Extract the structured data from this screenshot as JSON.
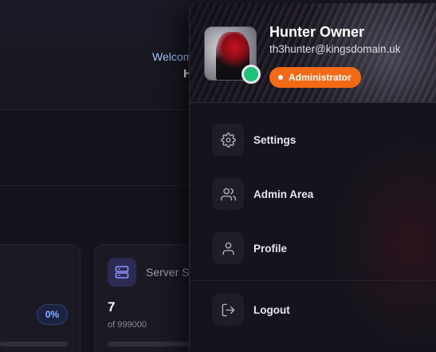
{
  "dashboard": {
    "welcome_text": "Welcome",
    "welcome_name": "H",
    "usage_percent_label": "0%",
    "server_card": {
      "title": "Server S",
      "value": "7",
      "of_text": "of 999000"
    }
  },
  "user_menu": {
    "name": "Hunter Owner",
    "email": "th3hunter@kingsdomain.uk",
    "role": "Administrator",
    "status": "online",
    "items": [
      {
        "label": "Settings",
        "icon": "gear-icon"
      },
      {
        "label": "Admin Area",
        "icon": "users-icon"
      },
      {
        "label": "Profile",
        "icon": "user-icon"
      },
      {
        "label": "Logout",
        "icon": "logout-icon"
      }
    ]
  },
  "colors": {
    "accent_orange": "#f26a16",
    "status_green": "#1ec177",
    "page_bg": "#15141c",
    "welcome_blue": "#a7c7ff"
  }
}
